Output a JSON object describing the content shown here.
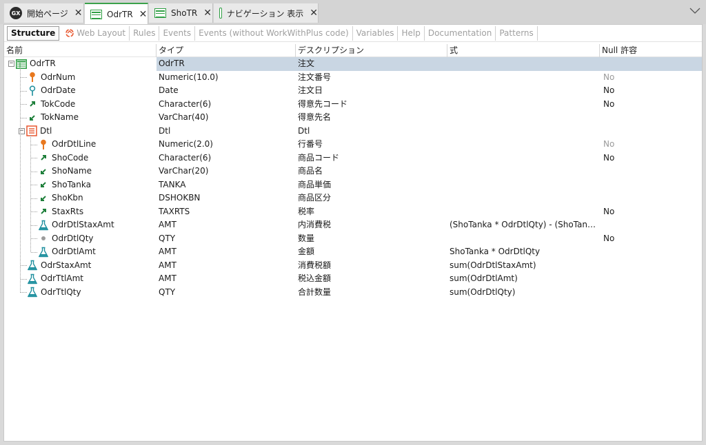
{
  "tabs": [
    {
      "label": "開始ページ",
      "icon": "genexus-logo-icon",
      "active": false
    },
    {
      "label": "OdrTR",
      "icon": "transaction-icon",
      "active": true
    },
    {
      "label": "ShoTR",
      "icon": "transaction-icon",
      "active": false
    },
    {
      "label": "ナビゲーション 表示",
      "icon": "navigation-report-icon",
      "active": false
    }
  ],
  "tab_logo_text": "GX",
  "close_glyph": "✕",
  "subtabs": [
    "Structure",
    "Web Layout",
    "Rules",
    "Events",
    "Events (without WorkWithPlus code)",
    "Variables",
    "Help",
    "Documentation",
    "Patterns"
  ],
  "columns": [
    "名前",
    "タイプ",
    "デスクリプション",
    "式",
    "Null 許容"
  ],
  "rows": [
    {
      "name": "OdrTR",
      "type": "OdrTR",
      "desc": "注文",
      "formula": "",
      "nullable": "",
      "icon": "transaction-icon",
      "level": 0
    },
    {
      "name": "OdrNum",
      "type": "Numeric(10.0)",
      "desc": "注文番号",
      "formula": "",
      "nullable": "No",
      "icon": "primary-key-icon",
      "level": 1
    },
    {
      "name": "OdrDate",
      "type": "Date",
      "desc": "注文日",
      "formula": "",
      "nullable": "No",
      "icon": "key-outline-icon",
      "level": 1
    },
    {
      "name": "TokCode",
      "type": "Character(6)",
      "desc": "得意先コード",
      "formula": "",
      "nullable": "No",
      "icon": "foreign-key-icon",
      "level": 1
    },
    {
      "name": "TokName",
      "type": "VarChar(40)",
      "desc": "得意先名",
      "formula": "",
      "nullable": "",
      "icon": "inferred-attribute-icon",
      "level": 1
    },
    {
      "name": "Dtl",
      "type": "Dtl",
      "desc": "Dtl",
      "formula": "",
      "nullable": "",
      "icon": "level-icon",
      "level": 1
    },
    {
      "name": "OdrDtlLine",
      "type": "Numeric(2.0)",
      "desc": "行番号",
      "formula": "",
      "nullable": "No",
      "icon": "primary-key-icon",
      "level": 2
    },
    {
      "name": "ShoCode",
      "type": "Character(6)",
      "desc": "商品コード",
      "formula": "",
      "nullable": "No",
      "icon": "foreign-key-icon",
      "level": 2
    },
    {
      "name": "ShoName",
      "type": "VarChar(20)",
      "desc": "商品名",
      "formula": "",
      "nullable": "",
      "icon": "inferred-attribute-icon",
      "level": 2
    },
    {
      "name": "ShoTanka",
      "type": "TANKA",
      "desc": "商品単価",
      "formula": "",
      "nullable": "",
      "icon": "inferred-attribute-icon",
      "level": 2
    },
    {
      "name": "ShoKbn",
      "type": "DSHOKBN",
      "desc": "商品区分",
      "formula": "",
      "nullable": "",
      "icon": "inferred-attribute-icon",
      "level": 2
    },
    {
      "name": "StaxRts",
      "type": "TAXRTS",
      "desc": "税率",
      "formula": "",
      "nullable": "No",
      "icon": "foreign-key-icon",
      "level": 2
    },
    {
      "name": "OdrDtlStaxAmt",
      "type": "AMT",
      "desc": "内消費税",
      "formula": "(ShoTanka * OdrDtlQty) - (ShoTank...",
      "nullable": "",
      "icon": "formula-icon",
      "level": 2
    },
    {
      "name": "OdrDtlQty",
      "type": "QTY",
      "desc": "数量",
      "formula": "",
      "nullable": "No",
      "icon": "attribute-dot-icon",
      "level": 2
    },
    {
      "name": "OdrDtlAmt",
      "type": "AMT",
      "desc": "金額",
      "formula": "ShoTanka * OdrDtlQty",
      "nullable": "",
      "icon": "formula-icon",
      "level": 2
    },
    {
      "name": "OdrStaxAmt",
      "type": "AMT",
      "desc": "消費税額",
      "formula": "sum(OdrDtlStaxAmt)",
      "nullable": "",
      "icon": "formula-icon",
      "level": 1
    },
    {
      "name": "OdrTtlAmt",
      "type": "AMT",
      "desc": "税込金額",
      "formula": "sum(OdrDtlAmt)",
      "nullable": "",
      "icon": "formula-icon",
      "level": 1
    },
    {
      "name": "OdrTtlQty",
      "type": "QTY",
      "desc": "合計数量",
      "formula": "sum(OdrDtlQty)",
      "nullable": "",
      "icon": "formula-icon",
      "level": 1
    }
  ],
  "colors": {
    "accent_green": "#2e9e43",
    "selection": "#c9d6e3",
    "key_orange": "#e8781e",
    "arrow_green": "#1e7f3a"
  }
}
